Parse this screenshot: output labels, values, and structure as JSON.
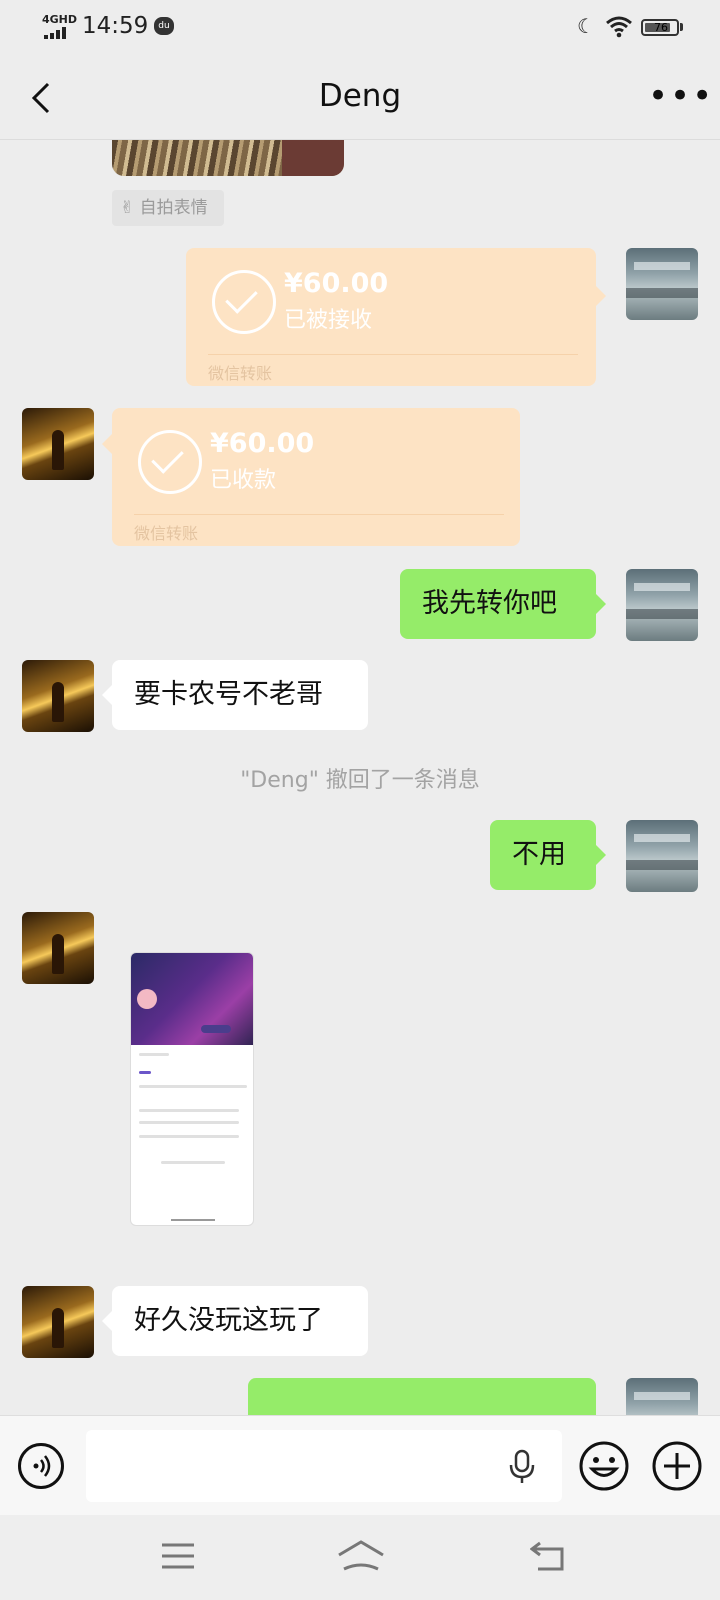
{
  "status_bar": {
    "network": "4GHD",
    "time": "14:59",
    "notification_badge": "du",
    "battery": "76"
  },
  "nav": {
    "title": "Deng",
    "back_icon": "chevron-left-icon",
    "more_icon": "more-icon"
  },
  "messages": {
    "selfie_tag": "自拍表情",
    "transfer_sent": {
      "amount": "¥60.00",
      "status": "已被接收",
      "footer": "微信转账"
    },
    "transfer_received": {
      "amount": "¥60.00",
      "status": "已收款",
      "footer": "微信转账"
    },
    "msg1": "我先转你吧",
    "msg2": "要卡农号不老哥",
    "recall_notice": "\"Deng\" 撤回了一条消息",
    "msg3": "不用",
    "msg4": "好久没玩这玩了"
  },
  "input_bar": {
    "voice_icon": "voice-icon",
    "mic_icon": "microphone-icon",
    "emoji_icon": "emoji-icon",
    "plus_icon": "plus-icon"
  },
  "colors": {
    "chat_bg": "#ededed",
    "green_bubble": "#95ec69",
    "transfer_bubble": "#fde3c4"
  }
}
